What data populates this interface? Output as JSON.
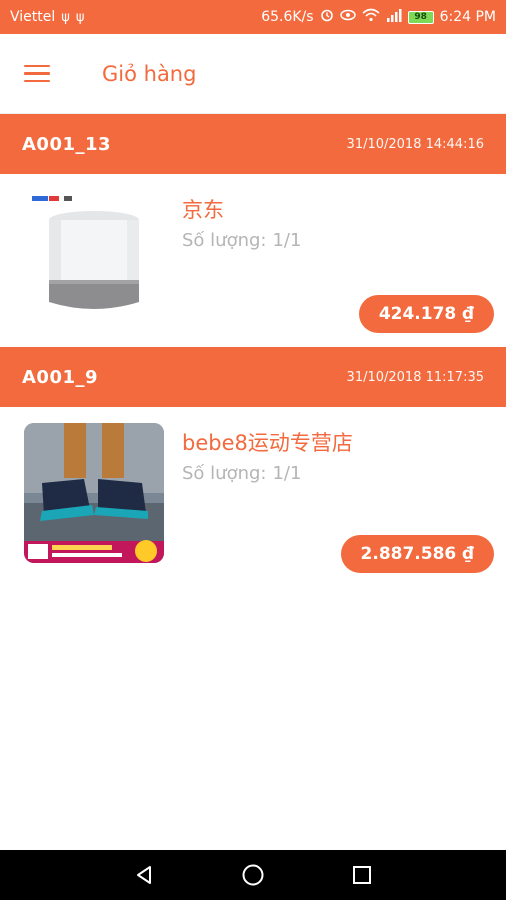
{
  "status_bar": {
    "carrier": "Viettel",
    "speed": "65.6K/s",
    "battery": "98",
    "time": "6:24 PM"
  },
  "app_bar": {
    "title": "Giỏ hàng",
    "menu_icon": "menu-icon"
  },
  "orders": [
    {
      "id": "A001_13",
      "date": "31/10/2018 14:44:16",
      "shop": "京东",
      "qty_label": "Số lượng:",
      "qty_value": "1/1",
      "price": "424.178 ₫",
      "image": "smart-speaker-image"
    },
    {
      "id": "A001_9",
      "date": "31/10/2018 11:17:35",
      "shop": "bebe8运动专营店",
      "qty_label": "Số lượng:",
      "qty_value": "1/1",
      "price": "2.887.586 ₫",
      "image": "sneakers-image"
    }
  ],
  "colors": {
    "accent": "#f26a3d",
    "muted_text": "#b5b5b5"
  }
}
